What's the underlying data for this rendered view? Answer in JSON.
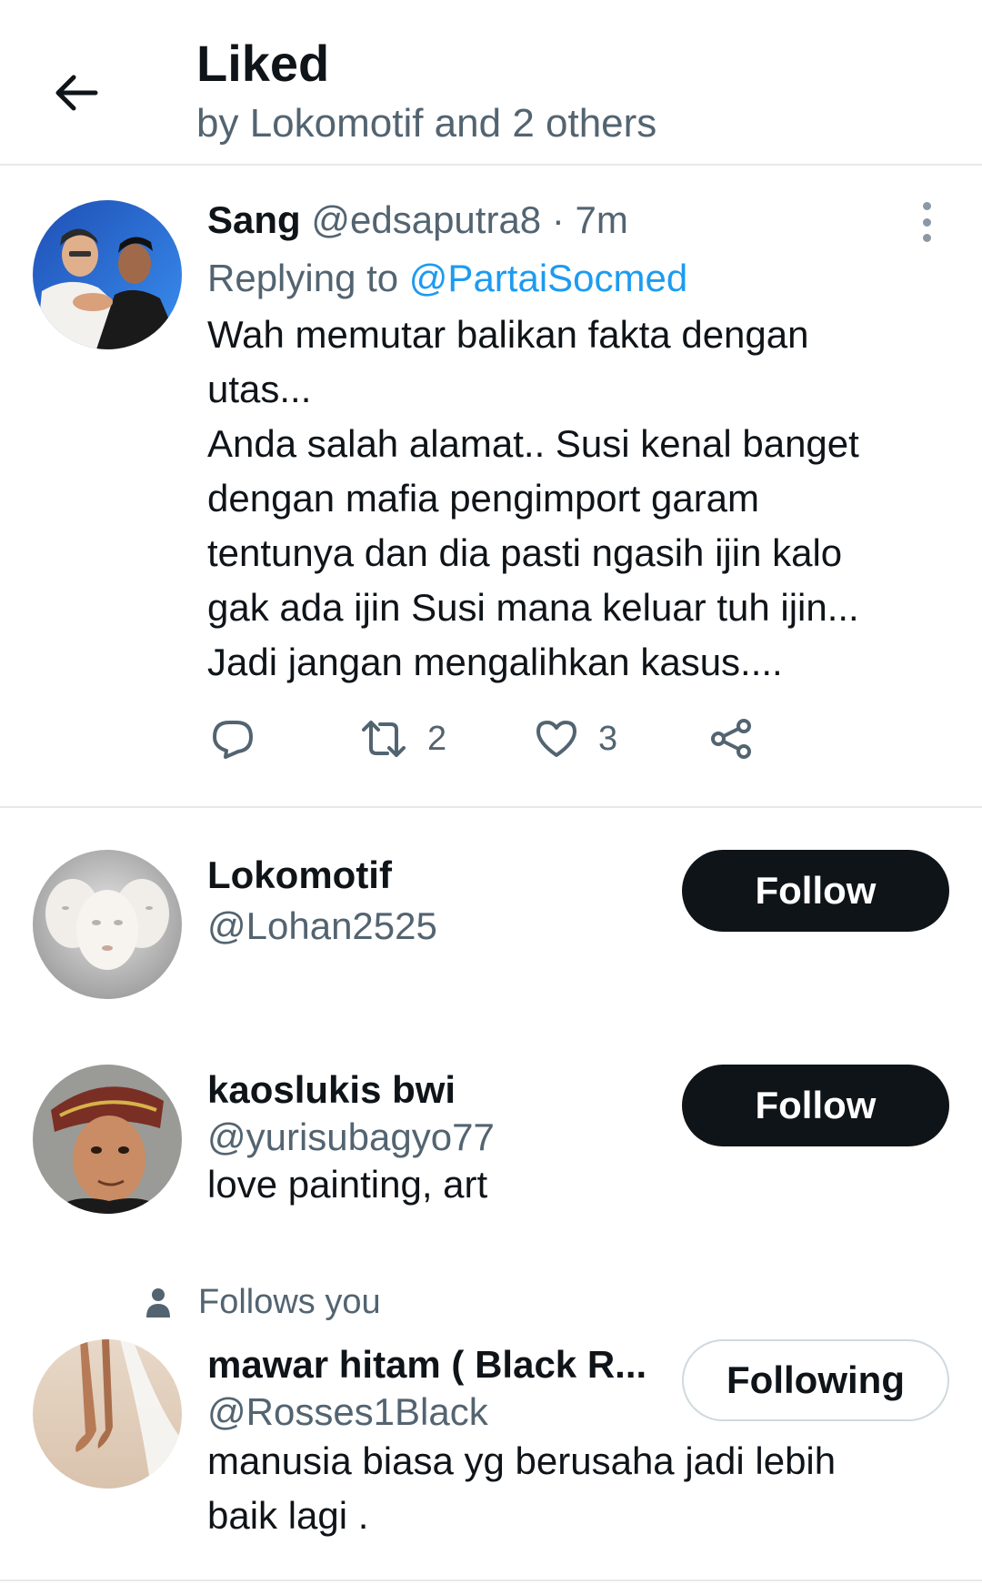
{
  "header": {
    "title": "Liked",
    "subtitle": "by Lokomotif and 2 others"
  },
  "tweet": {
    "name": "Sang",
    "handle": "@edsaputra8",
    "separator": " · ",
    "time": "7m",
    "replying_prefix": "Replying to ",
    "replying_to": "@PartaiSocmed",
    "text_lines": [
      "Wah memutar balikan fakta dengan",
      "utas...",
      "Anda salah alamat.. Susi kenal banget",
      "dengan mafia pengimport garam",
      "tentunya dan dia pasti ngasih ijin kalo",
      "gak ada ijin Susi mana keluar tuh ijin...",
      "Jadi jangan mengalihkan kasus...."
    ],
    "actions": {
      "reply_icon": "reply-icon",
      "retweet_icon": "retweet-icon",
      "retweet_count": "2",
      "like_icon": "heart-icon",
      "like_count": "3",
      "share_icon": "share-icon"
    }
  },
  "users": [
    {
      "name": "Lokomotif",
      "handle": "@Lohan2525",
      "bio": "",
      "button": "Follow"
    },
    {
      "name": "kaoslukis bwi",
      "handle": "@yurisubagyo77",
      "bio": "love painting, art",
      "button": "Follow"
    },
    {
      "follows_you": "Follows you",
      "name": "mawar hitam ( Black R...",
      "handle": "@Rosses1Black",
      "bio_lines": [
        "manusia biasa yg berusaha jadi lebih",
        "baik lagi ."
      ],
      "button": "Following"
    }
  ],
  "colors": {
    "text": "#0f1419",
    "secondary": "#536471",
    "link": "#1d9bf0",
    "divider": "#e6e9ec",
    "button_dark": "#0f1419"
  }
}
